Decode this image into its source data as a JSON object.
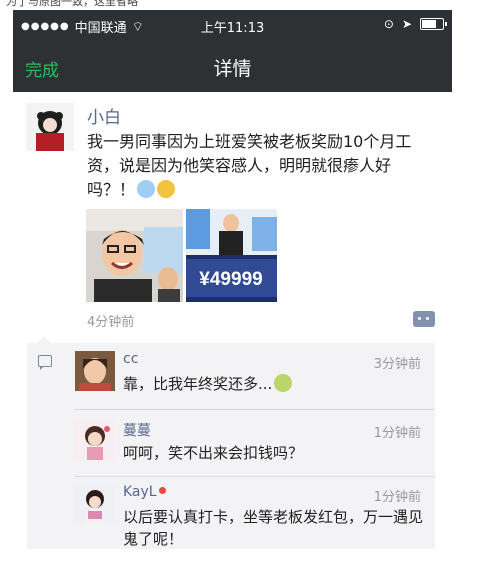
{
  "caption": "为了与原图一致，这里省略",
  "status_bar": {
    "carrier": "中国联通",
    "time": "上午11:13",
    "battery_level": 0.7
  },
  "nav": {
    "done_label": "完成",
    "title": "详情"
  },
  "post": {
    "author": "小白",
    "text": "我一男同事因为上班爱笑被老板奖励10个月工资，说是因为他笑容感人，明明就很瘆人好吗？！",
    "photo_2_caption": "¥49999",
    "time": "4分钟前"
  },
  "comments": [
    {
      "name": "cc",
      "time": "3分钟前",
      "text": "靠，比我年终奖还多..."
    },
    {
      "name": "蔓蔓",
      "time": "1分钟前",
      "text": "呵呵，笑不出来会扣钱吗？"
    },
    {
      "name": "KayL",
      "time": "1分钟前",
      "text": "以后要认真打卡，坐等老板发红包，万一遇见鬼了呢！"
    }
  ],
  "icons": [
    "wifi-icon",
    "location-icon",
    "battery-icon",
    "comment-menu-icon",
    "comment-bubble-icon"
  ],
  "colors": {
    "bar": "#2e3133",
    "done": "#23c060",
    "name": "#56668f"
  }
}
